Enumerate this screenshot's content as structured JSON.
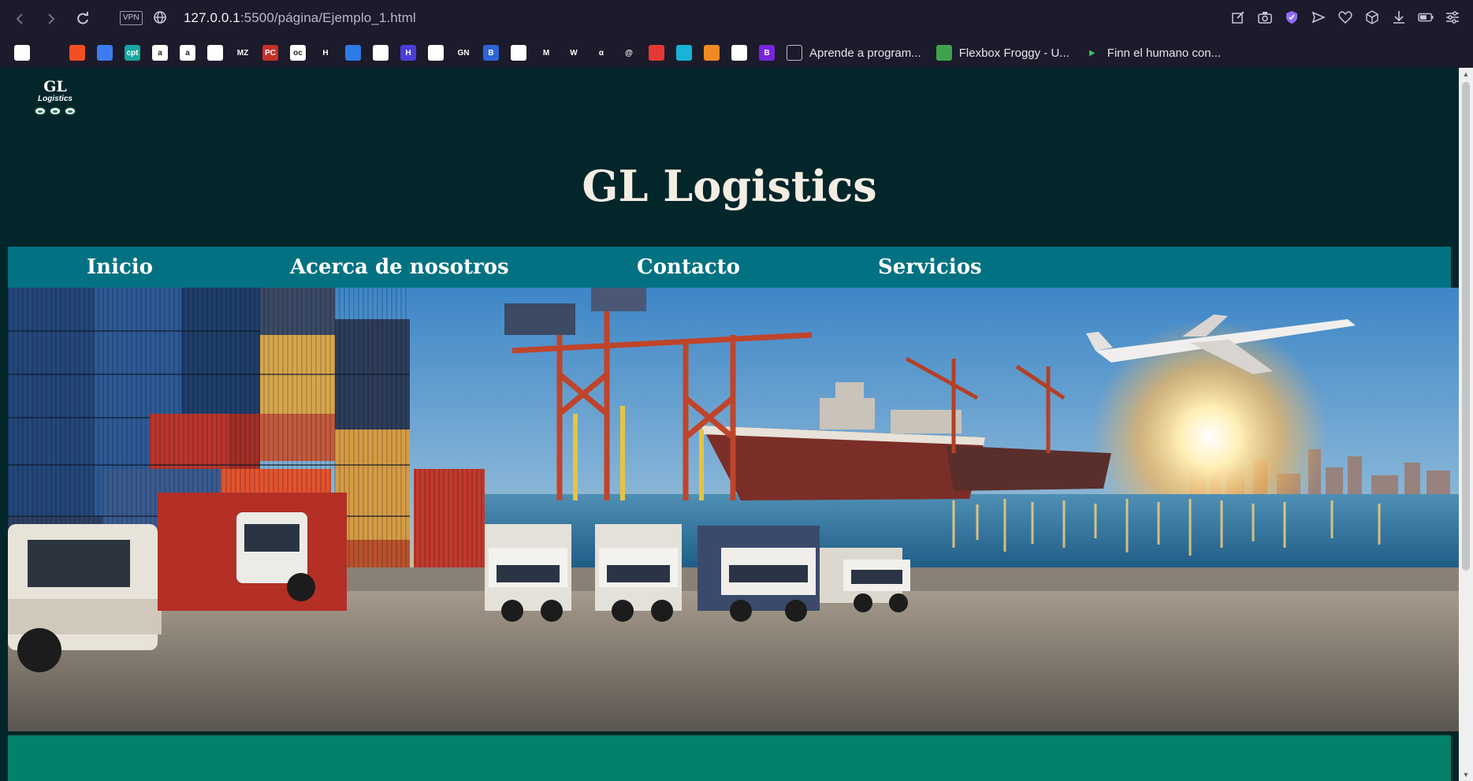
{
  "browser": {
    "url_host": "127.0.0.1",
    "url_path": ":5500/página/Ejemplo_1.html",
    "vpn_label": "VPN",
    "bookmarks": [
      {
        "icon": "notion-icon",
        "color": "#ffffff",
        "text": ""
      },
      {
        "icon": "audio-wave-icon",
        "color": "#1c1b2b",
        "text": ""
      },
      {
        "icon": "microsoft-icon",
        "color": "#f25022",
        "text": ""
      },
      {
        "icon": "apps-grid-icon",
        "color": "#3c7cf0",
        "text": ""
      },
      {
        "icon": "cpt-icon",
        "color": "#15a7a0",
        "text": "cpt"
      },
      {
        "icon": "amazon-icon",
        "color": "#ffffff",
        "text": "a"
      },
      {
        "icon": "amazon-icon",
        "color": "#ffffff",
        "text": "a"
      },
      {
        "icon": "document-icon",
        "color": "#ffffff",
        "text": ""
      },
      {
        "icon": "mz-icon",
        "color": "#1c1b2b",
        "text": "MZ"
      },
      {
        "icon": "pc-fusion-icon",
        "color": "#c7302c",
        "text": "PC"
      },
      {
        "icon": "oc-icon",
        "color": "#ffffff",
        "text": "oc"
      },
      {
        "icon": "h-icon",
        "color": "#1c1b2b",
        "text": "H"
      },
      {
        "icon": "circle-icon",
        "color": "#2e7be6",
        "text": ""
      },
      {
        "icon": "document-icon",
        "color": "#ffffff",
        "text": ""
      },
      {
        "icon": "hackerrank-icon",
        "color": "#4b3ddb",
        "text": "H"
      },
      {
        "icon": "image-icon",
        "color": "#ffffff",
        "text": ""
      },
      {
        "icon": "gn-icon",
        "color": "#1c1b2b",
        "text": "GN"
      },
      {
        "icon": "b-icon",
        "color": "#2d64d6",
        "text": "B"
      },
      {
        "icon": "panda-icon",
        "color": "#ffffff",
        "text": ""
      },
      {
        "icon": "m-icon",
        "color": "#1c1b2b",
        "text": "M"
      },
      {
        "icon": "w-icon",
        "color": "#1c1b2b",
        "text": "W"
      },
      {
        "icon": "alpha-icon",
        "color": "#1c1b2b",
        "text": "α"
      },
      {
        "icon": "at-icon",
        "color": "#1c1b2b",
        "text": "@"
      },
      {
        "icon": "record-icon",
        "color": "#e53935",
        "text": ""
      },
      {
        "icon": "cube-icon",
        "color": "#17b3d9",
        "text": ""
      },
      {
        "icon": "blocks-icon",
        "color": "#f08a24",
        "text": ""
      },
      {
        "icon": "document-icon",
        "color": "#ffffff",
        "text": ""
      },
      {
        "icon": "bootstrap-icon",
        "color": "#7a24e0",
        "text": "B"
      }
    ],
    "bookmark_links": [
      {
        "icon": "book-icon",
        "label": "Aprende a program..."
      },
      {
        "icon": "frog-icon",
        "label": "Flexbox Froggy - U..."
      },
      {
        "icon": "play-arrow-icon",
        "label": "Finn el humano con..."
      }
    ]
  },
  "site": {
    "logo_title": "GL",
    "logo_subtitle": "Logistics",
    "title": "GL Logistics",
    "menu": [
      "Inicio",
      "Acerca de nosotros",
      "Contacto",
      "Servicios"
    ],
    "colors": {
      "background": "#02262a",
      "menu": "#027282",
      "footer": "#03816a",
      "title": "#f4ede4"
    }
  }
}
